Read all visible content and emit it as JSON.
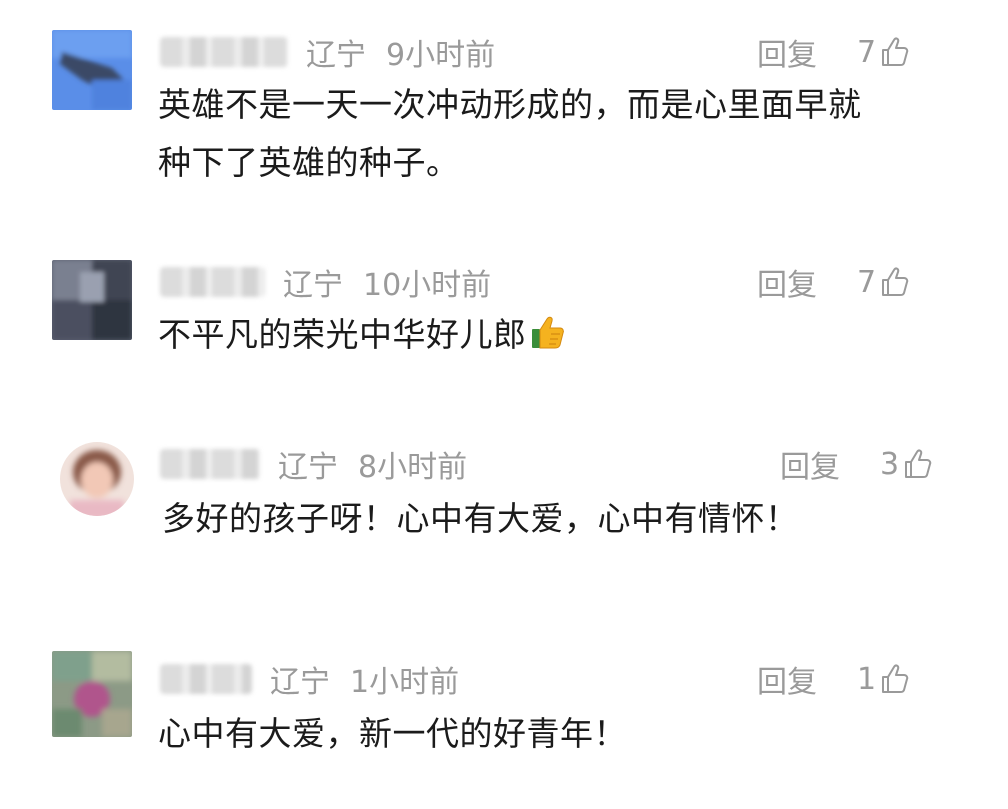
{
  "comments": [
    {
      "region": "辽宁",
      "time": "9小时前",
      "reply_label": "回复",
      "likes": "7",
      "text_line1": "英雄不是一天一次冲动形成的，而是心里面早就",
      "text_line2": "种下了英雄的种子。",
      "avatar_icon": "blurred-avatar-blue"
    },
    {
      "region": "辽宁",
      "time": "10小时前",
      "reply_label": "回复",
      "likes": "7",
      "text_line1": "不平凡的荣光中华好儿郎",
      "text_emoji": "thumbs-up-emoji",
      "avatar_icon": "blurred-avatar-dark"
    },
    {
      "region": "辽宁",
      "time": "8小时前",
      "reply_label": "回复",
      "likes": "3",
      "text_line1": "多好的孩子呀！心中有大爱，心中有情怀！",
      "avatar_icon": "blurred-avatar-portrait"
    },
    {
      "region": "辽宁",
      "time": "1小时前",
      "reply_label": "回复",
      "likes": "1",
      "text_line1": "心中有大爱，新一代的好青年！",
      "avatar_icon": "blurred-avatar-colorful"
    }
  ],
  "colors": {
    "meta_text": "#9a9a9a",
    "body_text": "#1b1b1b",
    "background": "#ffffff"
  }
}
